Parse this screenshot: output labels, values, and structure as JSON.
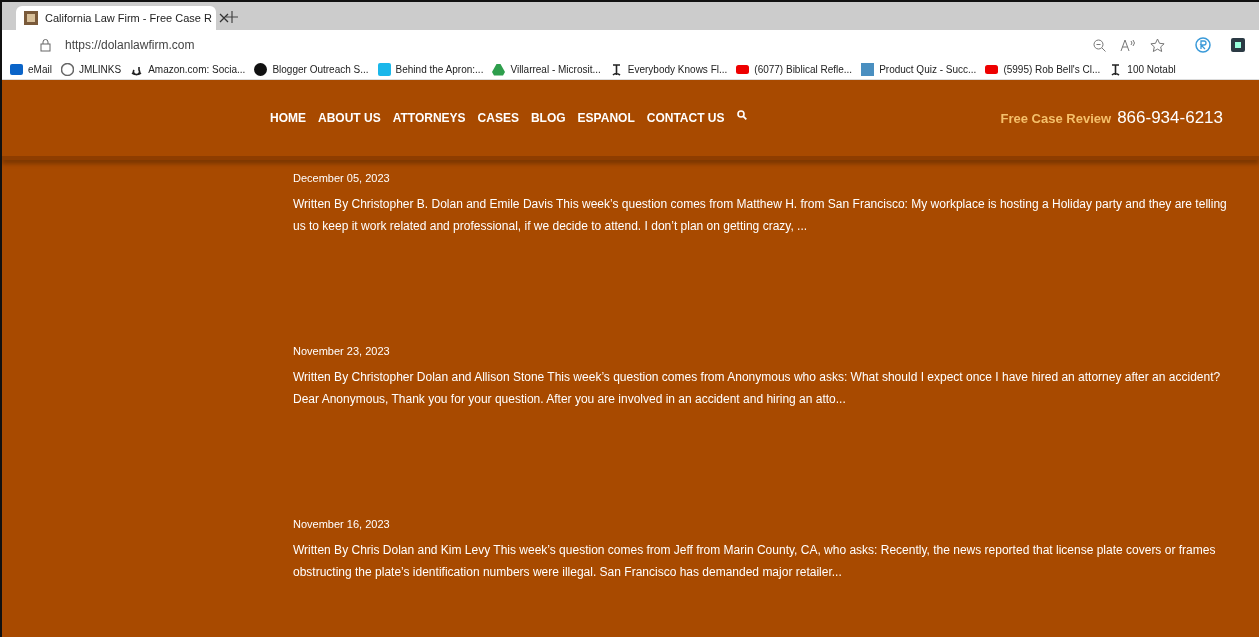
{
  "browser": {
    "tab": {
      "title": "California Law Firm - Free Case R"
    },
    "address": "https://dolanlawfirm.com",
    "bookmarks": [
      {
        "kind": "mail",
        "label": "eMail"
      },
      {
        "kind": "wp",
        "label": "JMLINKS"
      },
      {
        "kind": "amazon",
        "label": "Amazon.com: Socia..."
      },
      {
        "kind": "circle",
        "label": "Blogger Outreach S..."
      },
      {
        "kind": "v",
        "label": "Behind the Apron:..."
      },
      {
        "kind": "drive",
        "label": "Villarreal - Microsit..."
      },
      {
        "kind": "nyt",
        "label": "Everybody Knows Fl..."
      },
      {
        "kind": "youtube",
        "label": "(6077) Biblical Refle..."
      },
      {
        "kind": "bars",
        "label": "Product Quiz - Succ..."
      },
      {
        "kind": "youtube",
        "label": "(5995) Rob Bell's Cl..."
      },
      {
        "kind": "nyt",
        "label": "100 Notabl"
      }
    ]
  },
  "header": {
    "nav": [
      "HOME",
      "ABOUT US",
      "ATTORNEYS",
      "CASES",
      "BLOG",
      "ESPANOL",
      "CONTACT US"
    ],
    "cta_label": "Free Case Review",
    "phone": "866-934-6213"
  },
  "posts": [
    {
      "date": "December 05, 2023",
      "excerpt": "Written By Christopher B. Dolan and Emile Davis This week’s question comes from Matthew H. from San Francisco: My workplace is hosting a Holiday party and they are telling us to keep it work related and professional, if we decide to attend. I don’t plan on getting crazy, ..."
    },
    {
      "date": "November 23, 2023",
      "excerpt": "Written By Christopher Dolan and Allison Stone This week’s question comes from Anonymous who asks: What should I expect once I have hired an attorney after an accident?  Dear Anonymous,  Thank you for your question. After you are involved in an accident and hiring an atto..."
    },
    {
      "date": "November 16, 2023",
      "excerpt": "Written By Chris Dolan and Kim Levy This week’s question comes from Jeff from Marin County, CA, who asks: Recently, the news reported that license plate covers or frames obstructing the plate’s identification numbers were illegal. San Francisco has demanded major retailer..."
    }
  ]
}
